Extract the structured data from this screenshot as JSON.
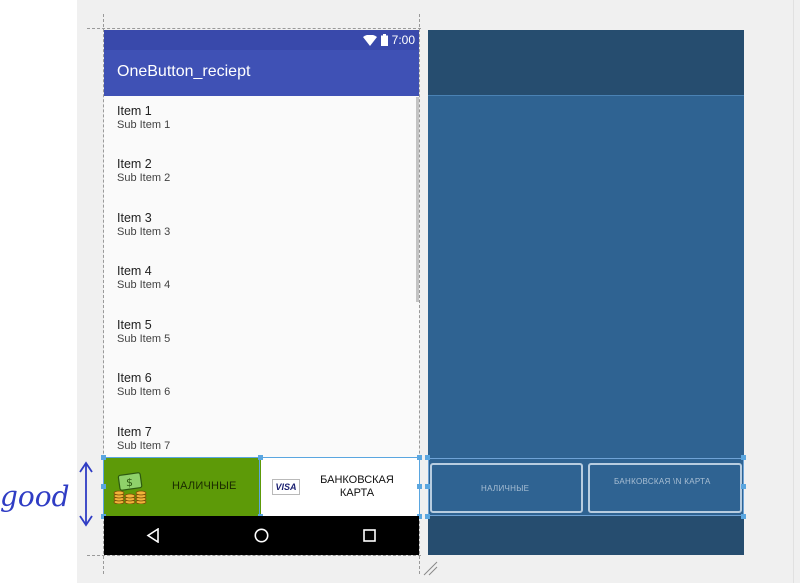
{
  "status_bar": {
    "time": "7:00"
  },
  "app": {
    "title": "OneButton_reciept"
  },
  "list": {
    "items": [
      {
        "title": "Item 1",
        "subtitle": "Sub Item 1"
      },
      {
        "title": "Item 2",
        "subtitle": "Sub Item 2"
      },
      {
        "title": "Item 3",
        "subtitle": "Sub Item 3"
      },
      {
        "title": "Item 4",
        "subtitle": "Sub Item 4"
      },
      {
        "title": "Item 5",
        "subtitle": "Sub Item 5"
      },
      {
        "title": "Item 6",
        "subtitle": "Sub Item 6"
      },
      {
        "title": "Item 7",
        "subtitle": "Sub Item 7"
      }
    ]
  },
  "buttons": {
    "cash_label": "НАЛИЧНЫЕ",
    "card_label_line1": "БАНКОВСКАЯ",
    "card_label_line2": "КАРТА",
    "card_icon_text": "VISA"
  },
  "blueprint": {
    "cash_label": "НАЛИЧНЫЕ",
    "card_label": "БАНКОВСКАЯ \\N КАРТА"
  },
  "annotation": {
    "text": "good"
  },
  "colors": {
    "app_bar": "#3f51b5",
    "status_bar": "#3949ab",
    "cash_button": "#5d9a08",
    "blueprint": "#2f6392",
    "selection": "#5aa6e0"
  }
}
